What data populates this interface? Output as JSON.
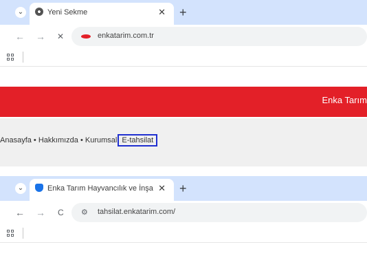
{
  "window1": {
    "tab": {
      "title": "Yeni Sekme",
      "favicon": "chrome-icon"
    },
    "address": {
      "url": "enkatarim.com.tr",
      "site_icon": "loading-icon"
    },
    "icons": {
      "back": "←",
      "forward": "→",
      "stop": "✕",
      "close": "✕",
      "new_tab": "+",
      "down": "⌄"
    }
  },
  "website": {
    "brand": "Enka Tarım",
    "nav": {
      "home": "Anasayfa",
      "about": "Hakkımızda",
      "corporate": "Kurumsal",
      "sep": " • ",
      "highlighted": "E-tahsilat"
    },
    "colors": {
      "red": "#e32028",
      "highlight_border": "#1f2fd0"
    }
  },
  "window2": {
    "tab": {
      "title": "Enka Tarım Hayvancılık ve İnşa",
      "favicon": "shield-icon"
    },
    "address": {
      "url": "tahsilat.enkatarim.com/"
    },
    "icons": {
      "back": "←",
      "forward": "→",
      "reload": "C",
      "close": "✕",
      "new_tab": "+",
      "down": "⌄",
      "site_info": "⚙"
    }
  }
}
